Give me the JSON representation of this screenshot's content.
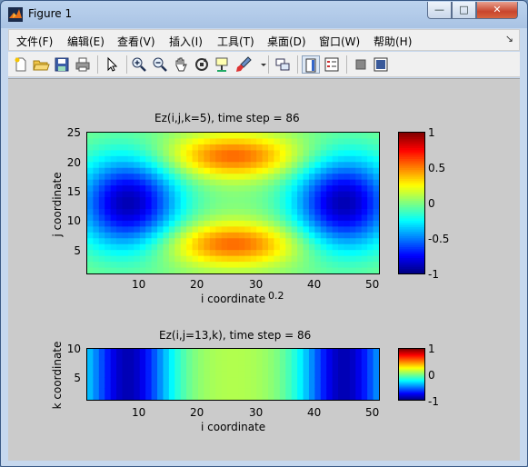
{
  "window": {
    "title": "Figure 1",
    "minimize_symbol": "—",
    "maximize_symbol": "□",
    "close_symbol": "✕"
  },
  "menu": [
    {
      "label": "文件(F)"
    },
    {
      "label": "编辑(E)"
    },
    {
      "label": "查看(V)"
    },
    {
      "label": "插入(I)"
    },
    {
      "label": "工具(T)"
    },
    {
      "label": "桌面(D)"
    },
    {
      "label": "窗口(W)"
    },
    {
      "label": "帮助(H)"
    }
  ],
  "menu_overflow_symbol": "↘",
  "toolbar": [
    "new-figure-icon",
    "open-file-icon",
    "save-icon",
    "print-icon",
    "edit-pointer-icon",
    "zoom-in-icon",
    "zoom-out-icon",
    "pan-hand-icon",
    "rotate-3d-icon",
    "data-cursor-icon",
    "brush-icon",
    "link-plot-icon",
    "colorbar-icon",
    "legend-icon",
    "hide-plot-tools-icon",
    "show-plot-tools-icon"
  ],
  "plots": {
    "top": {
      "title": "Ez(i,j,k=5), time step = 86",
      "xlabel": "i coordinate",
      "ylabel": "j coordinate",
      "stray_text": "0.2",
      "xticks": [
        "10",
        "20",
        "30",
        "40",
        "50"
      ],
      "yticks": [
        "25",
        "20",
        "15",
        "10",
        "5"
      ],
      "cbar_ticks": [
        "1",
        "0.5",
        "0",
        "-0.5",
        "-1"
      ]
    },
    "bottom": {
      "title": "Ez(i,j=13,k), time step = 86",
      "xlabel": "i coordinate",
      "ylabel": "k coordinate",
      "xticks": [
        "10",
        "20",
        "30",
        "40",
        "50"
      ],
      "yticks": [
        "10",
        "5"
      ],
      "cbar_ticks": [
        "1",
        "0",
        "-1"
      ]
    }
  },
  "chart_data": [
    {
      "type": "heatmap",
      "title": "Ez(i,j,k=5), time step = 86",
      "xlabel": "i coordinate",
      "ylabel": "j coordinate",
      "xlim": [
        1,
        51
      ],
      "ylim": [
        1,
        25
      ],
      "clim": [
        -1,
        1
      ],
      "colormap": "jet",
      "features": [
        {
          "kind": "min",
          "i": 8,
          "j": 13,
          "value": -0.9
        },
        {
          "kind": "min",
          "i": 45,
          "j": 13,
          "value": -0.9
        },
        {
          "kind": "max",
          "i": 26,
          "j": 21,
          "value": 0.55
        },
        {
          "kind": "max",
          "i": 26,
          "j": 6,
          "value": 0.55
        }
      ]
    },
    {
      "type": "heatmap",
      "title": "Ez(i,j=13,k), time step = 86",
      "xlabel": "i coordinate",
      "ylabel": "k coordinate",
      "xlim": [
        1,
        51
      ],
      "ylim": [
        1,
        10
      ],
      "clim": [
        -1,
        1
      ],
      "colormap": "jet",
      "features": [
        {
          "kind": "min",
          "i": 8,
          "value": -0.9
        },
        {
          "kind": "min",
          "i": 45,
          "value": -0.9
        },
        {
          "kind": "max",
          "i": 26,
          "value": 0.1
        }
      ]
    }
  ]
}
